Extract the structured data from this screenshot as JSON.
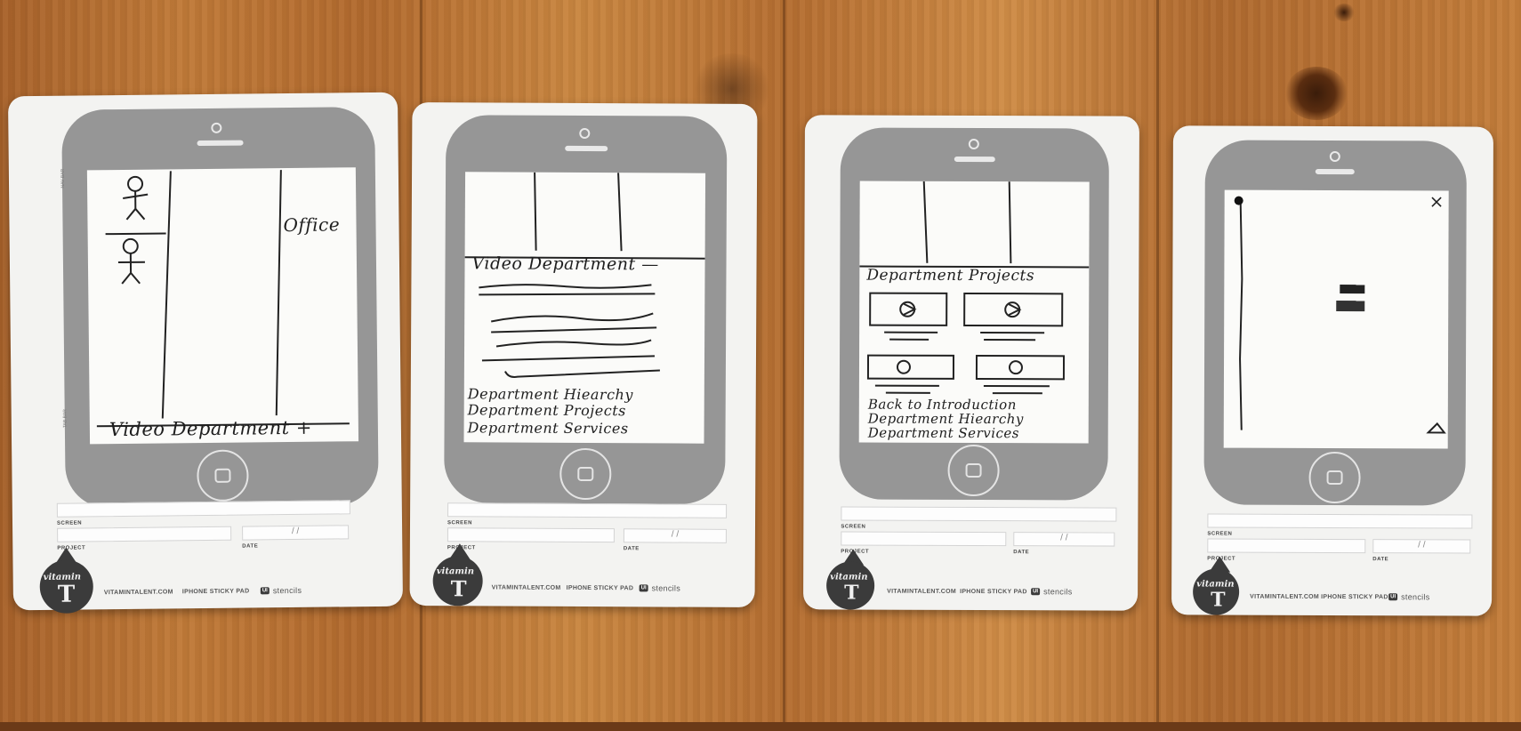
{
  "image": {
    "description_items": [
      "wooden-table",
      "four-paper-phone-sketches"
    ]
  },
  "sketches": [
    {
      "office_label": "Office",
      "footer_caption": "Video Department +"
    },
    {
      "heading": "Video Department —",
      "links": [
        "Department Hiearchy",
        "Department Projects",
        "Department Services"
      ]
    },
    {
      "heading": "Department Projects",
      "links": [
        "Back to Introduction",
        "Department Hiearchy",
        "Department Services"
      ]
    },
    {
      "close_glyph": "×"
    }
  ],
  "template": {
    "screen_label": "SCREEN",
    "project_label": "PROJECT",
    "date_label": "DATE",
    "date_sep": "/          /",
    "site": "VITAMINTALENT.COM",
    "pad": "IPHONE STICKY PAD",
    "ui_badge": "UI",
    "stencils": "stencils",
    "brand": "vitamin",
    "logo_letter": "T",
    "nav_bar": "NAV BAR",
    "tab_bar": "TAB BAR"
  }
}
